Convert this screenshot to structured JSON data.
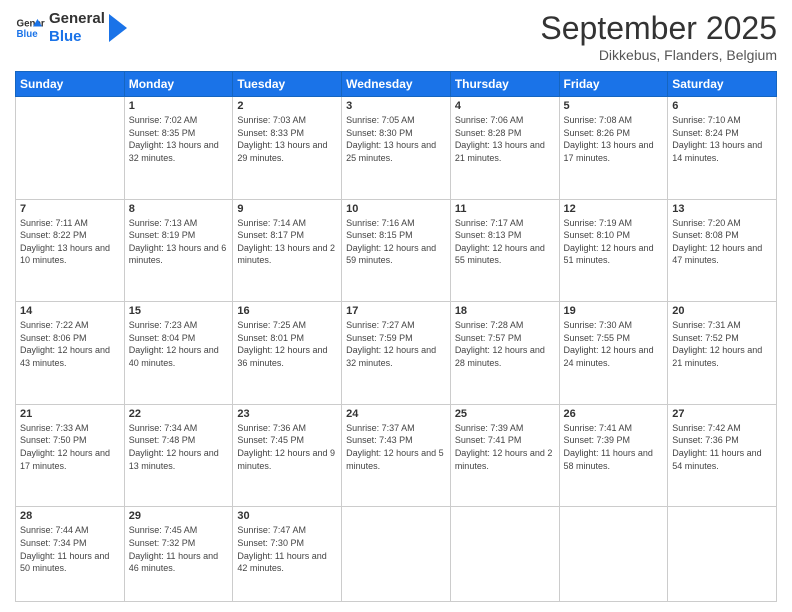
{
  "logo": {
    "text_general": "General",
    "text_blue": "Blue"
  },
  "header": {
    "month": "September 2025",
    "location": "Dikkebus, Flanders, Belgium"
  },
  "weekdays": [
    "Sunday",
    "Monday",
    "Tuesday",
    "Wednesday",
    "Thursday",
    "Friday",
    "Saturday"
  ],
  "weeks": [
    [
      {
        "day": "",
        "sunrise": "",
        "sunset": "",
        "daylight": ""
      },
      {
        "day": "1",
        "sunrise": "Sunrise: 7:02 AM",
        "sunset": "Sunset: 8:35 PM",
        "daylight": "Daylight: 13 hours and 32 minutes."
      },
      {
        "day": "2",
        "sunrise": "Sunrise: 7:03 AM",
        "sunset": "Sunset: 8:33 PM",
        "daylight": "Daylight: 13 hours and 29 minutes."
      },
      {
        "day": "3",
        "sunrise": "Sunrise: 7:05 AM",
        "sunset": "Sunset: 8:30 PM",
        "daylight": "Daylight: 13 hours and 25 minutes."
      },
      {
        "day": "4",
        "sunrise": "Sunrise: 7:06 AM",
        "sunset": "Sunset: 8:28 PM",
        "daylight": "Daylight: 13 hours and 21 minutes."
      },
      {
        "day": "5",
        "sunrise": "Sunrise: 7:08 AM",
        "sunset": "Sunset: 8:26 PM",
        "daylight": "Daylight: 13 hours and 17 minutes."
      },
      {
        "day": "6",
        "sunrise": "Sunrise: 7:10 AM",
        "sunset": "Sunset: 8:24 PM",
        "daylight": "Daylight: 13 hours and 14 minutes."
      }
    ],
    [
      {
        "day": "7",
        "sunrise": "Sunrise: 7:11 AM",
        "sunset": "Sunset: 8:22 PM",
        "daylight": "Daylight: 13 hours and 10 minutes."
      },
      {
        "day": "8",
        "sunrise": "Sunrise: 7:13 AM",
        "sunset": "Sunset: 8:19 PM",
        "daylight": "Daylight: 13 hours and 6 minutes."
      },
      {
        "day": "9",
        "sunrise": "Sunrise: 7:14 AM",
        "sunset": "Sunset: 8:17 PM",
        "daylight": "Daylight: 13 hours and 2 minutes."
      },
      {
        "day": "10",
        "sunrise": "Sunrise: 7:16 AM",
        "sunset": "Sunset: 8:15 PM",
        "daylight": "Daylight: 12 hours and 59 minutes."
      },
      {
        "day": "11",
        "sunrise": "Sunrise: 7:17 AM",
        "sunset": "Sunset: 8:13 PM",
        "daylight": "Daylight: 12 hours and 55 minutes."
      },
      {
        "day": "12",
        "sunrise": "Sunrise: 7:19 AM",
        "sunset": "Sunset: 8:10 PM",
        "daylight": "Daylight: 12 hours and 51 minutes."
      },
      {
        "day": "13",
        "sunrise": "Sunrise: 7:20 AM",
        "sunset": "Sunset: 8:08 PM",
        "daylight": "Daylight: 12 hours and 47 minutes."
      }
    ],
    [
      {
        "day": "14",
        "sunrise": "Sunrise: 7:22 AM",
        "sunset": "Sunset: 8:06 PM",
        "daylight": "Daylight: 12 hours and 43 minutes."
      },
      {
        "day": "15",
        "sunrise": "Sunrise: 7:23 AM",
        "sunset": "Sunset: 8:04 PM",
        "daylight": "Daylight: 12 hours and 40 minutes."
      },
      {
        "day": "16",
        "sunrise": "Sunrise: 7:25 AM",
        "sunset": "Sunset: 8:01 PM",
        "daylight": "Daylight: 12 hours and 36 minutes."
      },
      {
        "day": "17",
        "sunrise": "Sunrise: 7:27 AM",
        "sunset": "Sunset: 7:59 PM",
        "daylight": "Daylight: 12 hours and 32 minutes."
      },
      {
        "day": "18",
        "sunrise": "Sunrise: 7:28 AM",
        "sunset": "Sunset: 7:57 PM",
        "daylight": "Daylight: 12 hours and 28 minutes."
      },
      {
        "day": "19",
        "sunrise": "Sunrise: 7:30 AM",
        "sunset": "Sunset: 7:55 PM",
        "daylight": "Daylight: 12 hours and 24 minutes."
      },
      {
        "day": "20",
        "sunrise": "Sunrise: 7:31 AM",
        "sunset": "Sunset: 7:52 PM",
        "daylight": "Daylight: 12 hours and 21 minutes."
      }
    ],
    [
      {
        "day": "21",
        "sunrise": "Sunrise: 7:33 AM",
        "sunset": "Sunset: 7:50 PM",
        "daylight": "Daylight: 12 hours and 17 minutes."
      },
      {
        "day": "22",
        "sunrise": "Sunrise: 7:34 AM",
        "sunset": "Sunset: 7:48 PM",
        "daylight": "Daylight: 12 hours and 13 minutes."
      },
      {
        "day": "23",
        "sunrise": "Sunrise: 7:36 AM",
        "sunset": "Sunset: 7:45 PM",
        "daylight": "Daylight: 12 hours and 9 minutes."
      },
      {
        "day": "24",
        "sunrise": "Sunrise: 7:37 AM",
        "sunset": "Sunset: 7:43 PM",
        "daylight": "Daylight: 12 hours and 5 minutes."
      },
      {
        "day": "25",
        "sunrise": "Sunrise: 7:39 AM",
        "sunset": "Sunset: 7:41 PM",
        "daylight": "Daylight: 12 hours and 2 minutes."
      },
      {
        "day": "26",
        "sunrise": "Sunrise: 7:41 AM",
        "sunset": "Sunset: 7:39 PM",
        "daylight": "Daylight: 11 hours and 58 minutes."
      },
      {
        "day": "27",
        "sunrise": "Sunrise: 7:42 AM",
        "sunset": "Sunset: 7:36 PM",
        "daylight": "Daylight: 11 hours and 54 minutes."
      }
    ],
    [
      {
        "day": "28",
        "sunrise": "Sunrise: 7:44 AM",
        "sunset": "Sunset: 7:34 PM",
        "daylight": "Daylight: 11 hours and 50 minutes."
      },
      {
        "day": "29",
        "sunrise": "Sunrise: 7:45 AM",
        "sunset": "Sunset: 7:32 PM",
        "daylight": "Daylight: 11 hours and 46 minutes."
      },
      {
        "day": "30",
        "sunrise": "Sunrise: 7:47 AM",
        "sunset": "Sunset: 7:30 PM",
        "daylight": "Daylight: 11 hours and 42 minutes."
      },
      {
        "day": "",
        "sunrise": "",
        "sunset": "",
        "daylight": ""
      },
      {
        "day": "",
        "sunrise": "",
        "sunset": "",
        "daylight": ""
      },
      {
        "day": "",
        "sunrise": "",
        "sunset": "",
        "daylight": ""
      },
      {
        "day": "",
        "sunrise": "",
        "sunset": "",
        "daylight": ""
      }
    ]
  ]
}
